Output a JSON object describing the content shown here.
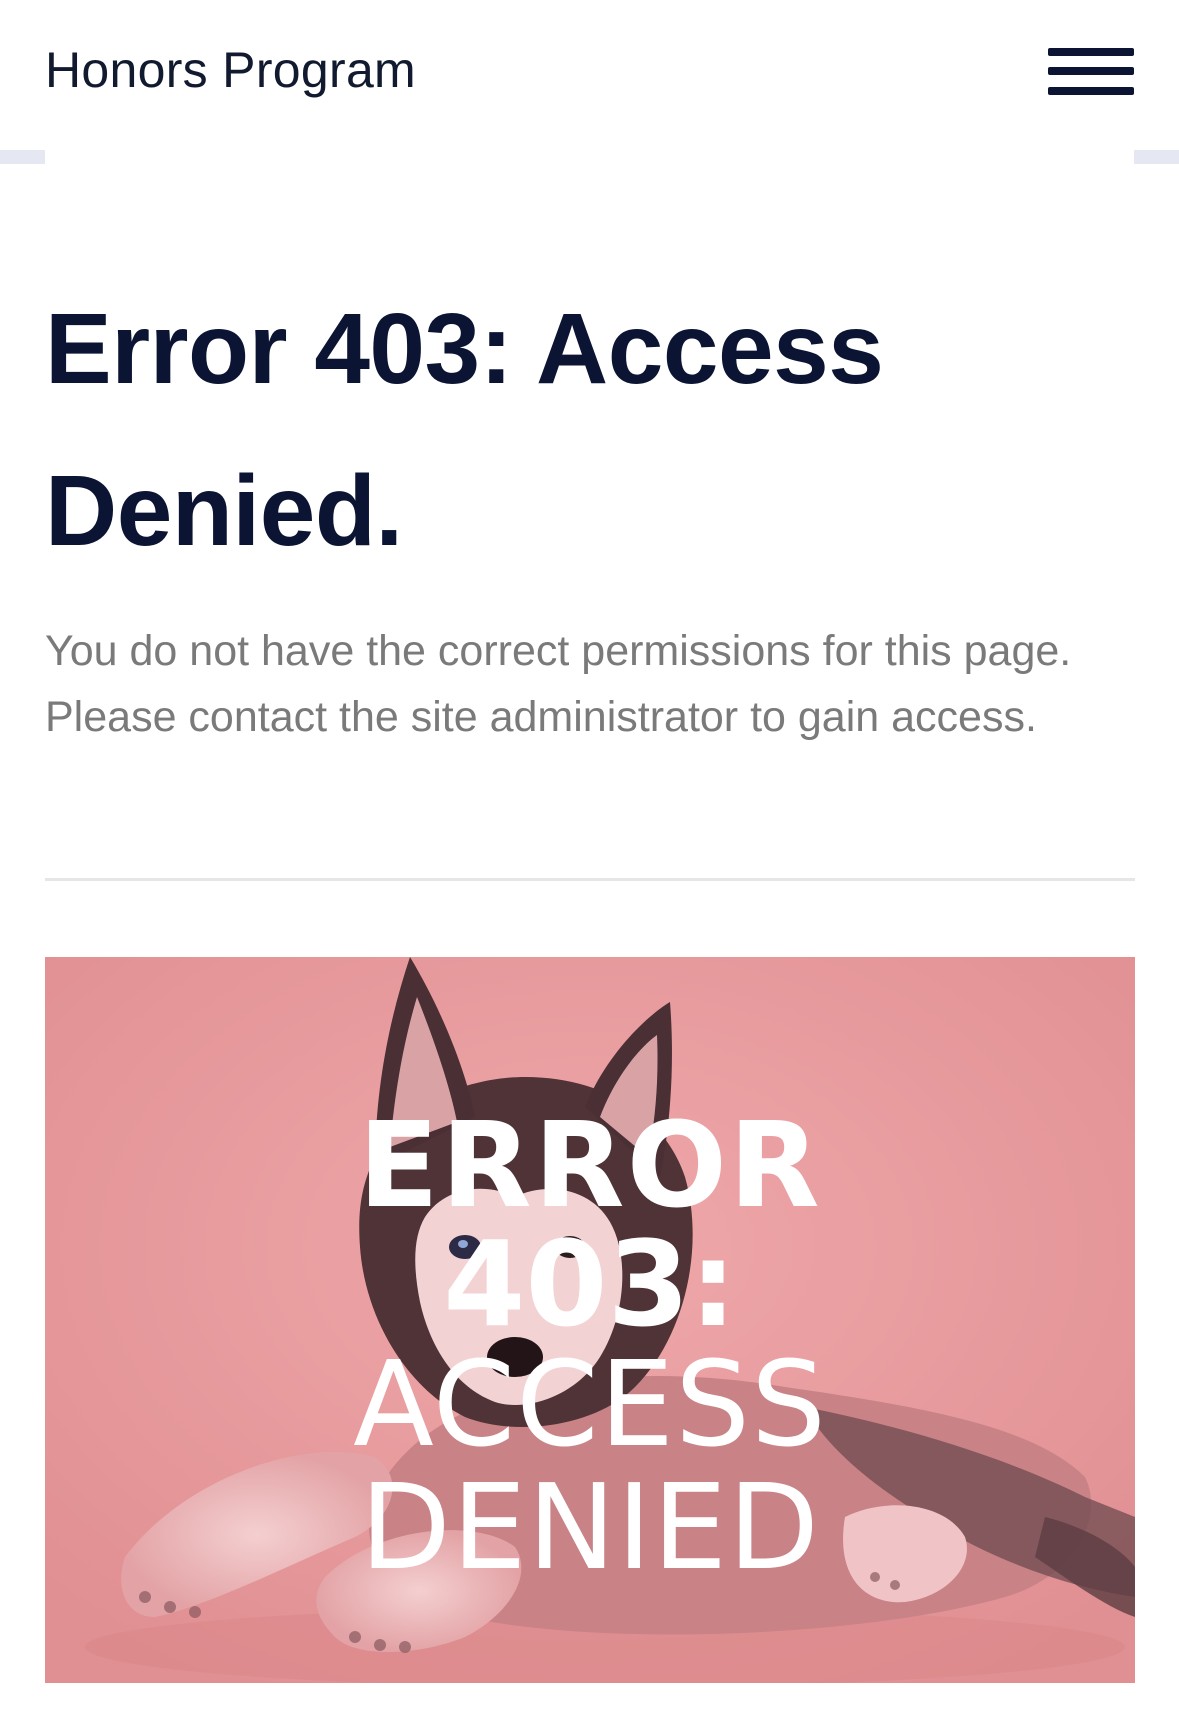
{
  "header": {
    "site_title": "Honors Program",
    "menu_icon": "hamburger-menu-icon"
  },
  "main": {
    "heading": "Error 403: Access Denied.",
    "intro": "You do not have the correct permissions for this page. Please contact the site administrator to gain access.",
    "image": {
      "lines": [
        "ERROR",
        "403:",
        "ACCESS",
        "DENIED"
      ],
      "overlay_color": "#e99a9c"
    }
  },
  "colors": {
    "heading": "#0b1533",
    "body_text": "#7a7a7a",
    "divider": "#e6e6e6"
  }
}
